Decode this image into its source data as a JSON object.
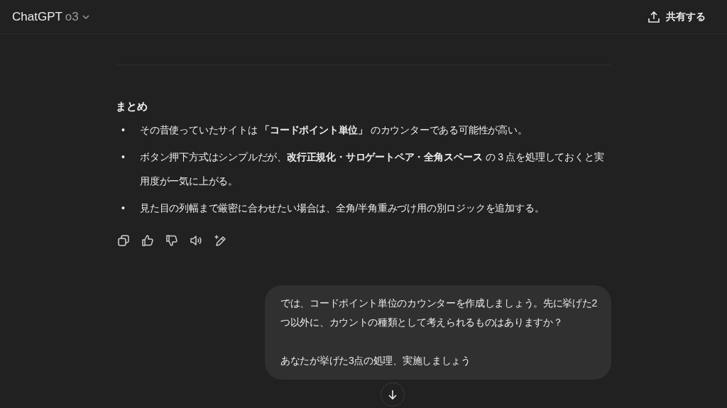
{
  "header": {
    "title": "ChatGPT",
    "model": "o3",
    "share_label": "共有する"
  },
  "answer": {
    "heading": "まとめ",
    "bullets": [
      {
        "marker": "•",
        "text": "その昔使っていたサイトは **「コードポイント単位」** のカウンターである可能性が高い。"
      },
      {
        "marker": "•",
        "text": "ボタン押下方式はシンプルだが、**改行正規化・サロゲートペア・全角スペース** の 3 点を処理しておくと実用度が一気に上がる。"
      },
      {
        "marker": "•",
        "text": "見た目の列幅まで厳密に合わせたい場合は、全角/半角重みづけ用の別ロジックを追加する。"
      }
    ]
  },
  "action_buttons": [
    {
      "kind": "copy"
    },
    {
      "kind": "like"
    },
    {
      "kind": "dislike"
    },
    {
      "kind": "speak"
    },
    {
      "kind": "edit"
    }
  ],
  "user_message": {
    "paragraphs": [
      "では、コードポイント単位のカウンターを作成しましょう。先に挙げた2つ以外に、カウントの種類として考えられるものはありますか？",
      "あなたが挙げた3点の処理、実施しましょう"
    ]
  }
}
